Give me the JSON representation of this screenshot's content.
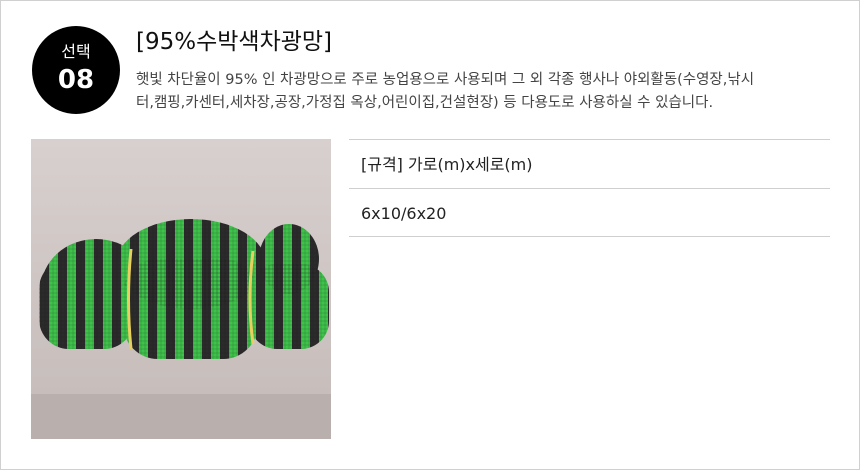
{
  "badge": {
    "label": "선택",
    "number": "08"
  },
  "product": {
    "title": "[95%수박색차광망]",
    "description_lines": [
      "햇빛 차단율이 95% 인 차광망으로 주로 농업용으로 사용되며 그 외 각종 행사나 야외활동(수영장,낚시",
      "터,캠핑,카센터,세차장,공장,가정집 옥상,어린이집,건설현장) 등 다용도로 사용하실 수 있습니다."
    ]
  },
  "spec": {
    "header": "[규격] 가로(m)x세로(m)",
    "value": "6x10/6x20"
  },
  "colors": {
    "net_green": "#3fc24a",
    "net_dark": "#2b2b2b",
    "background_wall": "#cfc6c4",
    "badge_bg": "#000000"
  }
}
